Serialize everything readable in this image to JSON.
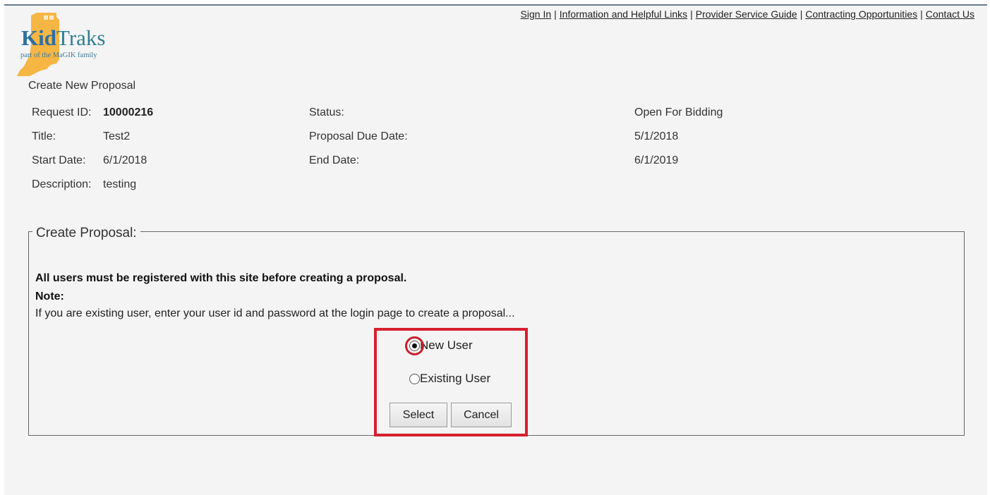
{
  "logo": {
    "brand_kid": "Kid",
    "brand_traks": "Traks",
    "tagline": "part of the MaGIK family"
  },
  "header": {
    "links": [
      "Sign In",
      "Information and Helpful Links",
      "Provider Service Guide",
      "Contracting Opportunities",
      "Contact Us"
    ]
  },
  "page_title": "Create New Proposal",
  "details": {
    "request_id_label": "Request ID:",
    "request_id": "10000216",
    "status_label": "Status:",
    "status": "Open For Bidding",
    "title_label": "Title:",
    "title": "Test2",
    "due_label": "Proposal Due Date:",
    "due": "5/1/2018",
    "start_label": "Start Date:",
    "start": "6/1/2018",
    "end_label": "End Date:",
    "end": "6/1/2019",
    "desc_label": "Description:",
    "desc": "testing"
  },
  "proposal": {
    "legend": "Create Proposal:",
    "notice": "All users must be registered with this site before creating a proposal.",
    "note_label": "Note:",
    "note_text": "If you are existing user, enter your user id and password at the login page to create a proposal...",
    "options": [
      "New User",
      "Existing User"
    ],
    "selected": "New User",
    "select_button": "Select",
    "cancel_button": "Cancel"
  },
  "colors": {
    "highlight": "#d6202e",
    "logo_state": "#f5a623",
    "logo_text": "#2f7f96"
  }
}
